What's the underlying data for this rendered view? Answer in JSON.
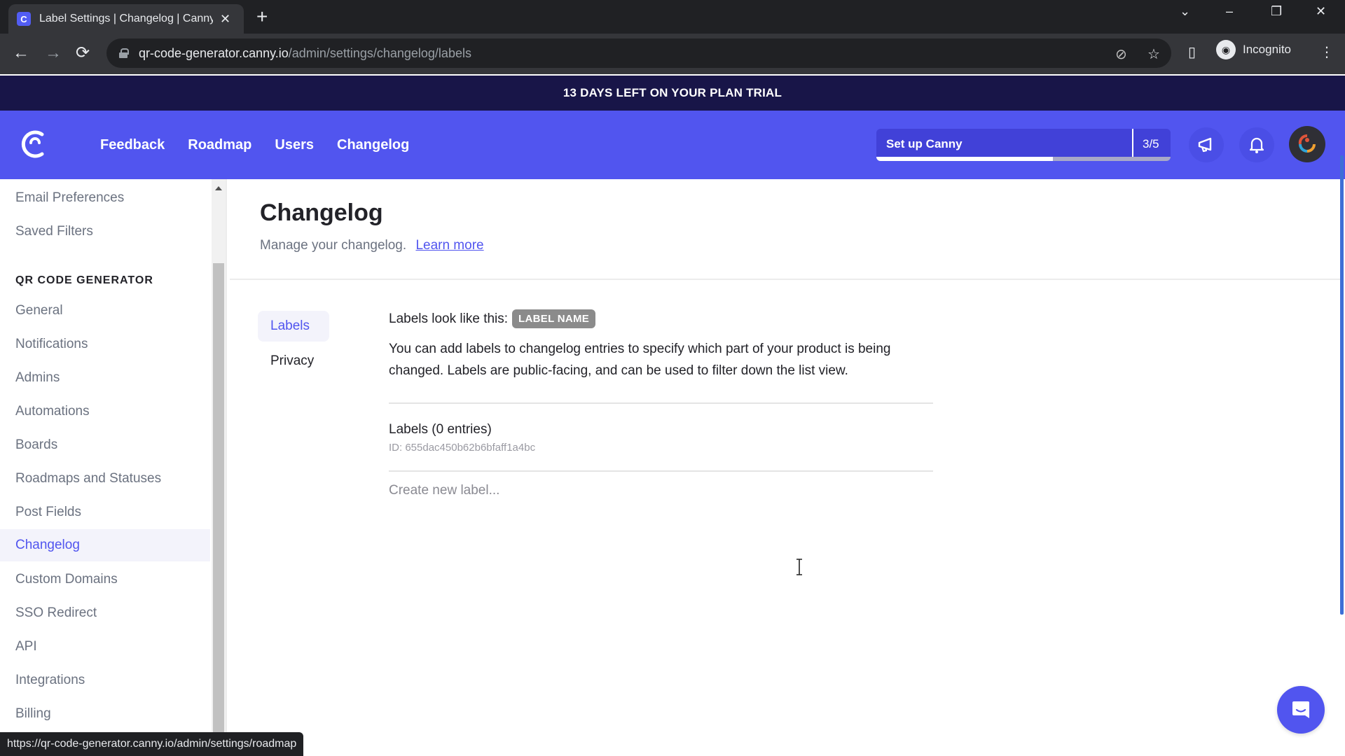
{
  "browser": {
    "tab_title": "Label Settings | Changelog | Canny",
    "url_host": "qr-code-generator.canny.io",
    "url_path": "/admin/settings/changelog/labels",
    "profile_label": "Incognito",
    "status_url": "https://qr-code-generator.canny.io/admin/settings/roadmap",
    "icons": {
      "back": "←",
      "forward": "→",
      "reload": "⟳",
      "new_tab": "+",
      "close_tab": "✕",
      "tab_search": "⌄",
      "minimize": "–",
      "restore": "❐",
      "close": "✕",
      "eye_off": "👁",
      "star": "☆",
      "side_panel": "▯",
      "menu": "⋮"
    }
  },
  "banner": {
    "text": "13 DAYS LEFT ON YOUR PLAN TRIAL"
  },
  "nav": {
    "links": [
      "Feedback",
      "Roadmap",
      "Users",
      "Changelog"
    ],
    "setup": {
      "label": "Set up Canny",
      "count": "3/5",
      "progress_fraction": 0.6
    },
    "colors": {
      "brand": "#5155ef",
      "banner": "#181548"
    }
  },
  "sidebar": {
    "top_items": [
      "Email Preferences",
      "Saved Filters"
    ],
    "section_heading": "QR CODE GENERATOR",
    "items": [
      "General",
      "Notifications",
      "Admins",
      "Automations",
      "Boards",
      "Roadmaps and Statuses",
      "Post Fields",
      "Changelog",
      "Custom Domains",
      "SSO Redirect",
      "API",
      "Integrations",
      "Billing"
    ],
    "active_item": "Changelog"
  },
  "main": {
    "title": "Changelog",
    "subtitle": "Manage your changelog.",
    "learn_more": "Learn more",
    "subnav": [
      "Labels",
      "Privacy"
    ],
    "active_subnav": "Labels",
    "look_prefix": "Labels look like this:",
    "badge_text": "LABEL NAME",
    "description": "You can add labels to changelog entries to specify which part of your product is being changed. Labels are public-facing, and can be used to filter down the list view.",
    "entries_title": "Labels (0 entries)",
    "entries_id": "ID: 655dac450b62b6bfaff1a4bc",
    "create_placeholder": "Create new label...",
    "create_value": ""
  }
}
